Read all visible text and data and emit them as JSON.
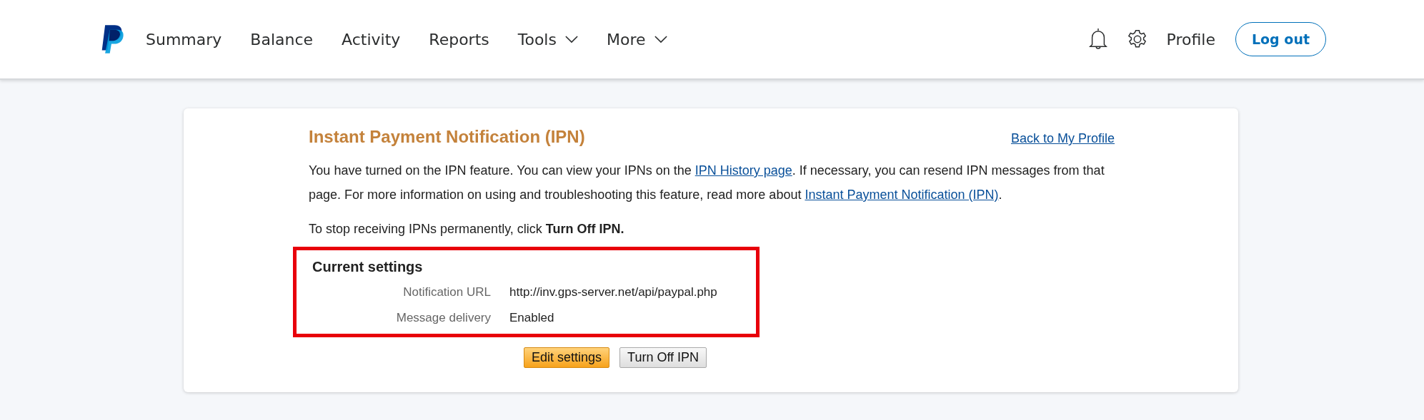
{
  "nav": {
    "items": [
      {
        "label": "Summary",
        "dropdown": false
      },
      {
        "label": "Balance",
        "dropdown": false
      },
      {
        "label": "Activity",
        "dropdown": false
      },
      {
        "label": "Reports",
        "dropdown": false
      },
      {
        "label": "Tools",
        "dropdown": true
      },
      {
        "label": "More",
        "dropdown": true
      }
    ],
    "profile": "Profile",
    "logout": "Log out"
  },
  "page": {
    "title": "Instant Payment Notification (IPN)",
    "back_link": "Back to My Profile",
    "intro": [
      {
        "kind": "text",
        "text": "You have turned on the IPN feature. You can view your IPNs on the "
      },
      {
        "kind": "link",
        "text": "IPN History page"
      },
      {
        "kind": "text",
        "text": ". If necessary, you can resend IPN messages from that page. For more information on using and troubleshooting this feature, read more about "
      },
      {
        "kind": "link",
        "text": "Instant Payment Notification (IPN)"
      },
      {
        "kind": "text",
        "text": "."
      }
    ],
    "stop_note": "To stop receiving IPNs permanently, click **Turn Off IPN.**",
    "settings": {
      "title": "Current settings",
      "highlighted": true,
      "rows": [
        {
          "label": "Notification URL",
          "value": "http://inv.gps-server.net/api/paypal.php"
        },
        {
          "label": "Message delivery",
          "value": "Enabled"
        }
      ]
    },
    "buttons": [
      {
        "label": "Edit settings",
        "kind": "primary"
      },
      {
        "label": "Turn Off IPN",
        "kind": "secondary"
      }
    ]
  }
}
